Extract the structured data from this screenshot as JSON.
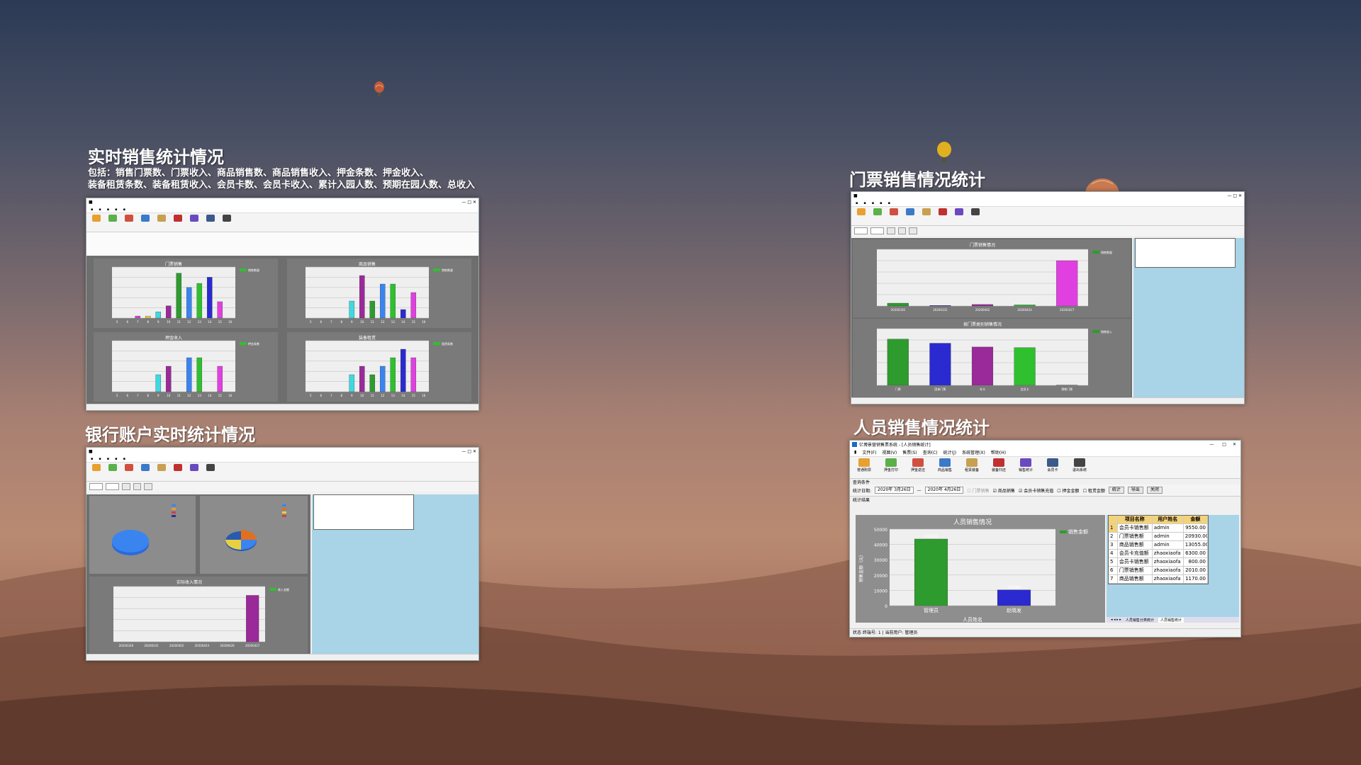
{
  "sections": {
    "realtime": {
      "title": "实时销售统计情况",
      "desc_line1": "包括：销售门票数、门票收入、商品销售数、商品销售收入、押金条数、押金收入、",
      "desc_line2": "装备租赁条数、装备租赁收入、会员卡数、会员卡收入、累计入园人数、预期在园人数、总收入"
    },
    "ticket": {
      "title": "门票销售情况统计"
    },
    "bank": {
      "title": "银行账户实时统计情况"
    },
    "staff": {
      "title": "人员销售情况统计"
    }
  },
  "staff_window": {
    "title": "亿博景营销售票系统 - [人员销售统计]",
    "menu": [
      "文件(F)",
      "视图(V)",
      "售票(S)",
      "查询(C)",
      "统计(J)",
      "系统管理(X)",
      "帮助(H)"
    ],
    "toolbar": [
      "普通购票",
      "押金打印",
      "押金返还",
      "商品销售",
      "租赁装备",
      "装备归还",
      "销售统计",
      "会员卡",
      "退出系统"
    ],
    "filter": {
      "group_label": "查询条件",
      "date_label": "统计日期:",
      "date_from": "2020年 3月26日",
      "dash": "—",
      "date_to": "2020年 4月26日",
      "chk_ticket": "门票销售",
      "chk_goods": "商品销售",
      "chk_card": "会员卡销售充值",
      "chk_deposit": "押金金额",
      "chk_rent": "租赁金额",
      "btn_stat": "统计",
      "btn_export": "导出",
      "btn_close": "关闭"
    },
    "result_label": "统计结果",
    "table": {
      "headers": [
        "项目名称",
        "用户姓名",
        "金额"
      ],
      "rows": [
        [
          "会员卡销售额",
          "admin",
          "9550.00"
        ],
        [
          "门票销售额",
          "admin",
          "20930.00"
        ],
        [
          "商品销售额",
          "admin",
          "13055.00"
        ],
        [
          "会员卡充值额",
          "zhaoxiaofa",
          "6300.00"
        ],
        [
          "会员卡销售额",
          "zhaoxiaofa",
          "800.00"
        ],
        [
          "门票销售额",
          "zhaoxiaofa",
          "2010.00"
        ],
        [
          "商品销售额",
          "zhaoxiaofa",
          "1170.00"
        ]
      ]
    },
    "tabs": [
      "人员销售分类统计",
      "人员销售统计"
    ],
    "status": "状态  终端号: 1 | 当前用户: 管理员"
  },
  "chart_data": [
    {
      "type": "bar",
      "title": "人员销售情况",
      "categories": [
        "管理员",
        "赵晓发"
      ],
      "series": [
        {
          "name": "销售金额",
          "values": [
            43535,
            10280
          ]
        }
      ],
      "data_labels": [
        "43535",
        "10280"
      ],
      "xlabel": "人员姓名",
      "ylabel": "销售金额（元）",
      "ylim": [
        0,
        50000
      ],
      "yticks": [
        "50000",
        "40000",
        "30000",
        "20000",
        "10000",
        "0"
      ],
      "colors": [
        "#2e9b2e",
        "#2a2ad0"
      ]
    },
    {
      "type": "bar",
      "title": "门票销售情况",
      "categories": [
        "20200326",
        "20200331",
        "20200402",
        "20200424",
        "20200427"
      ],
      "series": [
        {
          "name": "销售数量",
          "values": [
            1500,
            300,
            800,
            600,
            24000
          ]
        }
      ],
      "ylim": [
        0,
        30000
      ],
      "colors": [
        "#2e9b2e",
        "#2a2ad0",
        "#9a2a9a",
        "#2ec02e",
        "#e040e0"
      ]
    },
    {
      "type": "bar",
      "title": "按门票类别销售情况",
      "categories": [
        "门票",
        "团体门票",
        "年卡",
        "会员卡",
        "预售门票"
      ],
      "series": [
        {
          "name": "销售收入",
          "values": [
            24500,
            22300,
            20300,
            20000,
            100
          ]
        }
      ],
      "ylim": [
        0,
        30000
      ],
      "colors": [
        "#2e9b2e",
        "#2a2ad0",
        "#9a2a9a",
        "#2ec02e",
        "#e040e0"
      ]
    },
    {
      "type": "bar",
      "title": "门票销售",
      "categories": [
        "5",
        "6",
        "7",
        "8",
        "9",
        "10",
        "11",
        "12",
        "13",
        "14",
        "15",
        "16"
      ],
      "series": [
        {
          "name": "销售数量",
          "values": [
            0,
            0,
            1,
            1,
            3,
            6,
            22,
            15,
            17,
            20,
            8,
            0
          ]
        }
      ],
      "ylim": [
        0,
        25
      ]
    },
    {
      "type": "bar",
      "title": "商品销售",
      "categories": [
        "5",
        "6",
        "7",
        "8",
        "9",
        "10",
        "11",
        "12",
        "13",
        "14",
        "15",
        "16"
      ],
      "series": [
        {
          "name": "销售数量",
          "values": [
            0,
            0,
            0,
            0,
            2,
            5,
            2,
            4,
            4,
            1,
            3,
            0
          ]
        }
      ],
      "ylim": [
        0,
        6
      ]
    },
    {
      "type": "bar",
      "title": "押金收入",
      "categories": [
        "5",
        "6",
        "7",
        "8",
        "9",
        "10",
        "11",
        "12",
        "13",
        "14",
        "15",
        "16"
      ],
      "series": [
        {
          "name": "押金条数",
          "values": [
            0,
            0,
            0,
            0,
            2,
            3,
            0,
            4,
            4,
            0,
            3,
            0
          ]
        }
      ],
      "ylim": [
        0,
        6
      ]
    },
    {
      "type": "bar",
      "title": "装备租赁",
      "categories": [
        "5",
        "6",
        "7",
        "8",
        "9",
        "10",
        "11",
        "12",
        "13",
        "14",
        "15",
        "16"
      ],
      "series": [
        {
          "name": "租赁条数",
          "values": [
            0,
            0,
            0,
            0,
            2,
            3,
            2,
            3,
            4,
            5,
            4,
            0
          ]
        }
      ],
      "ylim": [
        0,
        6
      ]
    },
    {
      "type": "bar",
      "title": "实际收入情况",
      "categories": [
        "20200326",
        "20200331",
        "20200402",
        "20200424",
        "20200426",
        "20200427"
      ],
      "series": [
        {
          "name": "收入金额",
          "values": [
            0,
            0,
            0,
            0,
            0,
            84000
          ]
        }
      ],
      "ylim": [
        0,
        100000
      ]
    }
  ]
}
